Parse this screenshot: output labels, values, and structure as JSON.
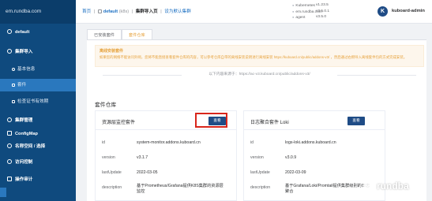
{
  "sidebar": {
    "brand": "em.rundba.com",
    "items": [
      {
        "label": "default",
        "kind": "group"
      },
      {
        "label": "集群导入",
        "kind": "group"
      },
      {
        "label": "基本信息",
        "kind": "sub"
      },
      {
        "label": "套件",
        "kind": "sub",
        "active": true
      },
      {
        "label": "检查证书有效期",
        "kind": "sub"
      },
      {
        "label": "集群管理",
        "kind": "group"
      },
      {
        "label": "ConfigMap",
        "kind": "group"
      },
      {
        "label": "名称空间 / 选择",
        "kind": "group"
      },
      {
        "label": "访问控制",
        "kind": "group"
      },
      {
        "label": "操作审计",
        "kind": "group"
      }
    ]
  },
  "header": {
    "crumbs": {
      "home": "首页",
      "cluster": "default",
      "cluster_tag": "(k8s)",
      "page": "集群导入页",
      "default_ns": "设为默认集群"
    },
    "versions": [
      {
        "name": "Kubernetes",
        "value": "v1.23.5"
      },
      {
        "name": "em.rundba.com",
        "value": "v3.5.0.1"
      },
      {
        "name": "agent",
        "value": "v3.5.0"
      }
    ],
    "logo_letter": "K",
    "user": "kuboard-admin"
  },
  "tabs": [
    {
      "label": "已安装套件",
      "active": false
    },
    {
      "label": "套件仓库",
      "active": true
    }
  ],
  "warning": {
    "title": "离线安装套件",
    "text": "如果您的网络不能访问外网，您将不能直接查看套件仓库的内容，可以参考仓库自带的离线安装说明进行离线安装 https://kuboard.cn/public/addons-v3/ ，然后通过右侧导入离线套件包的方式完成安装。"
  },
  "url_line": "以下内容来源于：https://ac-v3.kuboard.cn/public/addons-v3/",
  "section_title": "套件仓库",
  "cards": [
    {
      "title": "资源层监控套件",
      "button": "查看",
      "rows": [
        {
          "key": "id",
          "value": "system-monitor.addons.kuboard.cn"
        },
        {
          "key": "version",
          "value": "v3.1.7"
        },
        {
          "key": "lastUpdate",
          "value": "2022-03-05"
        },
        {
          "key": "description",
          "value": "基于Prometheus/Grafana提供K8S集群的资源层监控"
        }
      ]
    },
    {
      "title": "日志聚合套件 Loki",
      "button": "查看",
      "rows": [
        {
          "key": "id",
          "value": "logs-loki.addons.kuboard.cn"
        },
        {
          "key": "version",
          "value": "v3.0.9"
        },
        {
          "key": "lastUpdate",
          "value": "2022-03-09"
        },
        {
          "key": "description",
          "value": "基于Grafana/Loki/Promtail提供集群级别的日志聚合"
        }
      ]
    }
  ],
  "watermark": "rundba"
}
